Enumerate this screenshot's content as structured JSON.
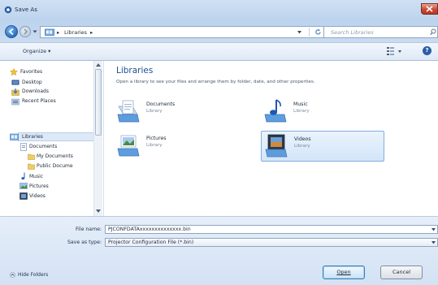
{
  "window": {
    "title": "Save As"
  },
  "address_bar": {
    "crumbs": [
      "Libraries"
    ],
    "search_placeholder": "Search Libraries"
  },
  "toolbar": {
    "organize_label": "Organize ▾"
  },
  "nav_pane": {
    "items": [
      {
        "label": "Favorites",
        "icon": "star-icon"
      },
      {
        "label": "Desktop",
        "icon": "desktop-icon"
      },
      {
        "label": "Downloads",
        "icon": "downloads-icon"
      },
      {
        "label": "Recent Places",
        "icon": "recent-places-icon"
      },
      {
        "label": "Libraries",
        "icon": "libraries-icon"
      },
      {
        "label": "Documents",
        "icon": "documents-icon"
      },
      {
        "label": "My Documents",
        "icon": "folder-icon"
      },
      {
        "label": "Public Docume",
        "icon": "folder-icon"
      },
      {
        "label": "Music",
        "icon": "music-icon"
      },
      {
        "label": "Pictures",
        "icon": "pictures-icon"
      },
      {
        "label": "Videos",
        "icon": "videos-icon"
      }
    ],
    "selected": "Libraries"
  },
  "content": {
    "heading": "Libraries",
    "description": "Open a library to see your files and arrange them by folder, date, and other properties.",
    "libraries": [
      {
        "name": "Documents",
        "type": "Library",
        "icon": "documents-library-icon"
      },
      {
        "name": "Music",
        "type": "Library",
        "icon": "music-library-icon"
      },
      {
        "name": "Pictures",
        "type": "Library",
        "icon": "pictures-library-icon"
      },
      {
        "name": "Videos",
        "type": "Library",
        "icon": "videos-library-icon",
        "selected": true
      }
    ]
  },
  "form": {
    "file_name_label": "File name:",
    "file_name_value": "PJCONFDATAxxxxxxxxxxxxxx.bin",
    "save_type_label": "Save as type:",
    "save_type_value": "Projector Configuration File (*.bin)"
  },
  "footer": {
    "hide_folders_label": "Hide Folders",
    "open_label": "Open",
    "cancel_label": "Cancel"
  },
  "colors": {
    "accent": "#1e4d8f",
    "selection": "#d3e5fa",
    "close_button": "#c74a33"
  }
}
